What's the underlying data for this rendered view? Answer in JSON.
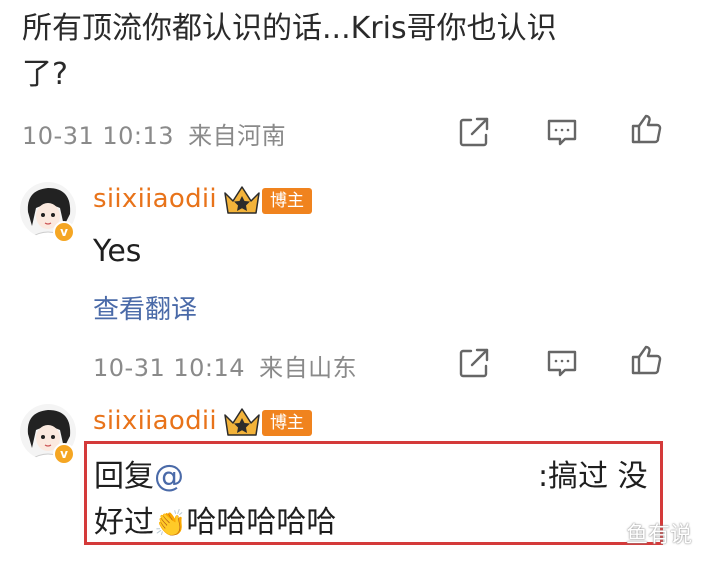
{
  "post": {
    "text_line1": "所有顶流你都认识的话...Kris哥你也认识",
    "text_line2": "了?",
    "time": "10-31 10:13",
    "location": "来自河南"
  },
  "comments": [
    {
      "username": "siixiiaodii",
      "tag": "博主",
      "text": "Yes",
      "translate_label": "查看翻译",
      "time": "10-31 10:14",
      "location": "来自山东"
    },
    {
      "username": "siixiiaodii",
      "tag": "博主",
      "reply_prefix": "回复",
      "mention": "@",
      "reply_middle": ":搞过 没",
      "reply_line2": "好过",
      "reply_emoji": "👏",
      "reply_laugh": "哈哈哈哈哈"
    }
  ],
  "watermark": "鱼有说",
  "icons": [
    "share-icon",
    "comment-icon",
    "like-icon",
    "crown-badge-icon",
    "verified-badge-icon"
  ],
  "colors": {
    "username": "#e8731a",
    "link": "#4a6aa8",
    "tag": "#f0831e",
    "highlight_border": "#d43a3a"
  }
}
